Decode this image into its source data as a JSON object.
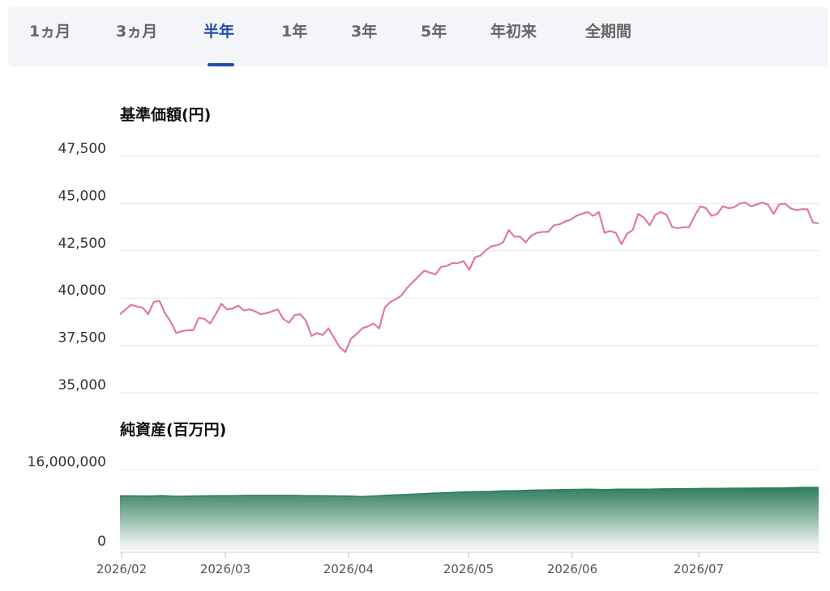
{
  "tabs": [
    {
      "label": "1ヵ月",
      "active": false
    },
    {
      "label": "3ヵ月",
      "active": false
    },
    {
      "label": "半年",
      "active": true
    },
    {
      "label": "1年",
      "active": false
    },
    {
      "label": "3年",
      "active": false
    },
    {
      "label": "5年",
      "active": false
    },
    {
      "label": "年初来",
      "active": false
    },
    {
      "label": "全期間",
      "active": false
    }
  ],
  "colors": {
    "accent": "#1f4fa8",
    "price_line": "#e07a98",
    "nav_area": "#2f7d5c"
  },
  "chart_data": [
    {
      "type": "line",
      "title": "基準価額(円)",
      "ylim": [
        35000,
        47500
      ],
      "yticks": [
        "47,500",
        "45,000",
        "42,500",
        "40,000",
        "37,500",
        "35,000"
      ],
      "grid": true,
      "series": [
        {
          "values": [
            39150,
            39400,
            39650,
            39550,
            39500,
            39150,
            39800,
            39850,
            39200,
            38750,
            38150,
            38250,
            38300,
            38300,
            38950,
            38900,
            38650,
            39150,
            39700,
            39400,
            39450,
            39600,
            39350,
            39400,
            39300,
            39150,
            39200,
            39300,
            39400,
            38900,
            38700,
            39100,
            39150,
            38800,
            38000,
            38150,
            38050,
            38400,
            37900,
            37400,
            37150,
            37850,
            38100,
            38400,
            38500,
            38650,
            38400,
            39500,
            39800,
            39950,
            40150,
            40550,
            40850,
            41150,
            41450,
            41350,
            41250,
            41650,
            41700,
            41850,
            41850,
            41950,
            41500,
            42150,
            42250,
            42550,
            42750,
            42800,
            42950,
            43600,
            43250,
            43250,
            42950,
            43300,
            43450,
            43500,
            43500,
            43850,
            43900,
            44050,
            44150,
            44350,
            44450,
            44550,
            44350,
            44550,
            43450,
            43550,
            43450,
            42850,
            43400,
            43600,
            44450,
            44250,
            43850,
            44400,
            44550,
            44400,
            43750,
            43700,
            43750,
            43750,
            44350,
            44850,
            44750,
            44350,
            44450,
            44850,
            44750,
            44800,
            45000,
            45050,
            44850,
            44950,
            45050,
            44950,
            44450,
            44950,
            45000,
            44750,
            44650,
            44700,
            44700,
            44000,
            43950
          ]
        }
      ]
    },
    {
      "type": "area",
      "title": "純資産(百万円)",
      "ylim": [
        0,
        16000000
      ],
      "yticks": [
        "16,000,000",
        "0"
      ],
      "grid": true,
      "x_labels": [
        "2026/02",
        "2026/03",
        "2026/04",
        "2026/05",
        "2026/06",
        "2026/07"
      ],
      "series": [
        {
          "values": [
            10700000,
            10700000,
            10650000,
            10750000,
            10600000,
            10650000,
            10700000,
            10750000,
            10750000,
            10800000,
            10800000,
            10800000,
            10800000,
            10750000,
            10750000,
            10700000,
            10650000,
            10550000,
            10700000,
            10850000,
            10950000,
            11100000,
            11250000,
            11350000,
            11500000,
            11550000,
            11600000,
            11700000,
            11750000,
            11850000,
            11900000,
            11950000,
            12000000,
            12050000,
            11950000,
            12050000,
            12050000,
            12050000,
            12100000,
            12150000,
            12150000,
            12200000,
            12200000,
            12250000,
            12250000,
            12300000,
            12300000,
            12350000,
            12400000,
            12400000
          ]
        }
      ]
    }
  ]
}
